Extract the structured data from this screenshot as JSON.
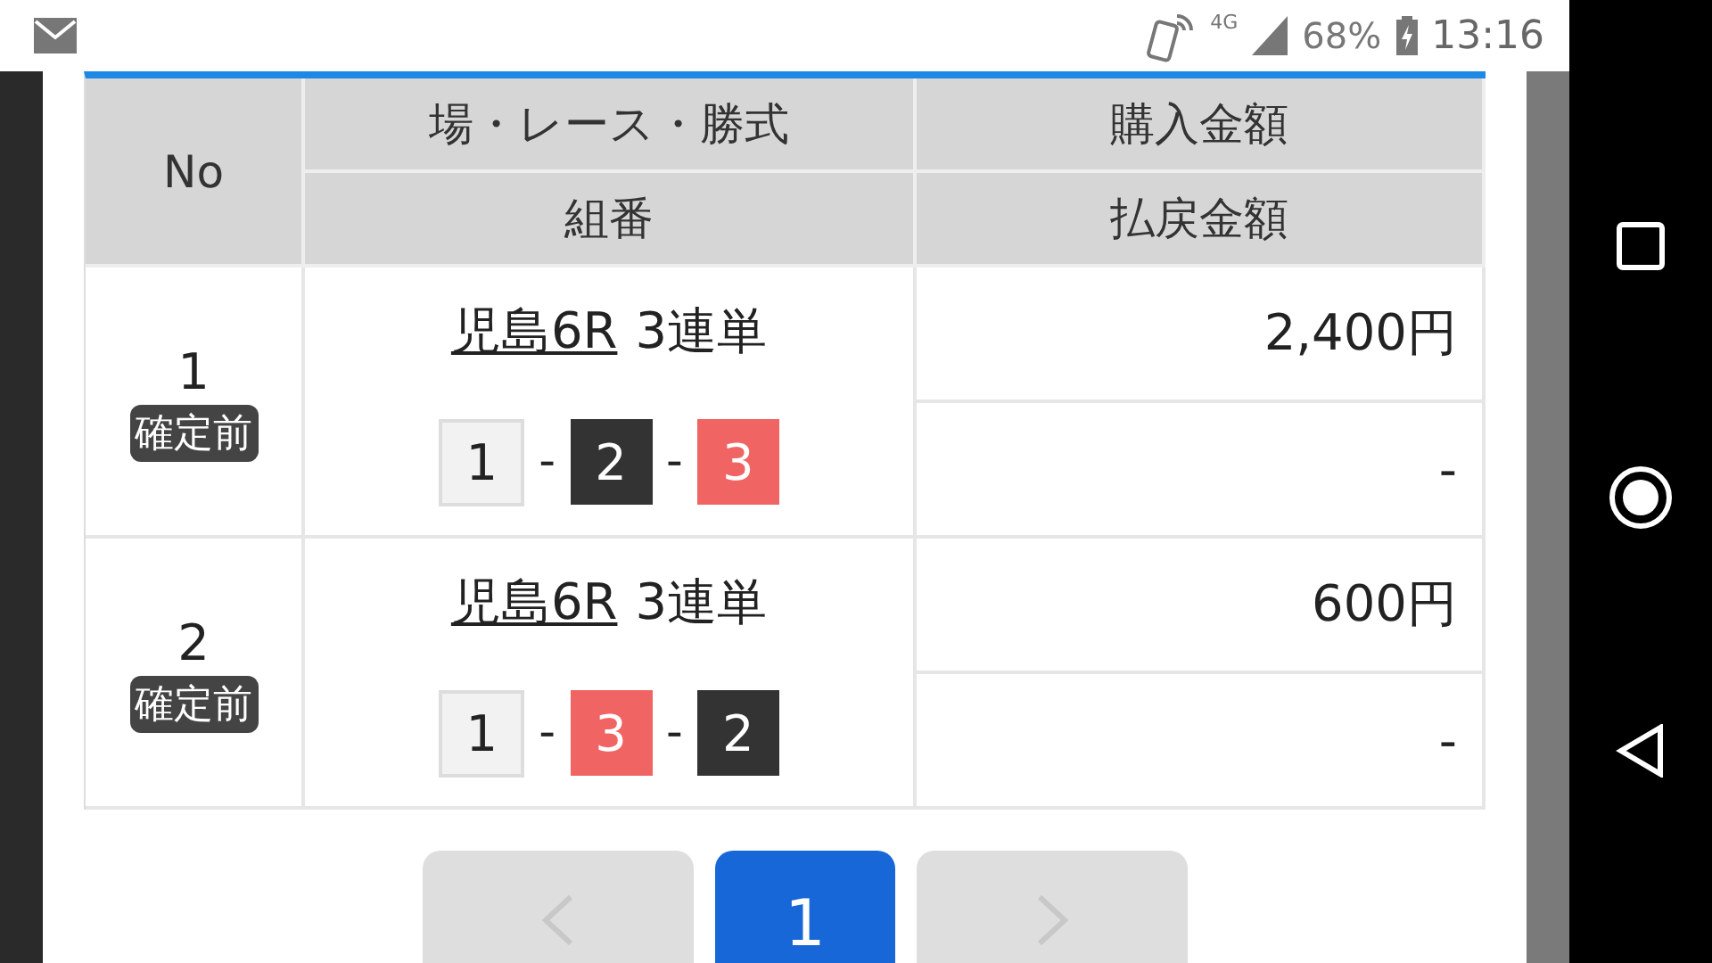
{
  "status_bar": {
    "network": "4G",
    "battery": "68%",
    "time": "13:16"
  },
  "table": {
    "header": {
      "no": "No",
      "race": "場・レース・勝式",
      "combination": "組番",
      "purchase": "購入金額",
      "payout": "払戻金額"
    },
    "rows": [
      {
        "no": "1",
        "status": "確定前",
        "race": "児島6R",
        "bet_type": "3連単",
        "picks": [
          {
            "number": "1",
            "color": "#f2f2f2"
          },
          {
            "number": "2",
            "color": "#333333"
          },
          {
            "number": "3",
            "color": "#f06464"
          }
        ],
        "separators": [
          "-",
          "-"
        ],
        "purchase": "2,400円",
        "payout": "-"
      },
      {
        "no": "2",
        "status": "確定前",
        "race": "児島6R",
        "bet_type": "3連単",
        "picks": [
          {
            "number": "1",
            "color": "#f2f2f2"
          },
          {
            "number": "3",
            "color": "#f06464"
          },
          {
            "number": "2",
            "color": "#333333"
          }
        ],
        "separators": [
          "-",
          "-"
        ],
        "purchase": "600円",
        "payout": "-"
      }
    ]
  },
  "pagination": {
    "pages": [
      {
        "label": "1",
        "selected": true
      }
    ]
  }
}
